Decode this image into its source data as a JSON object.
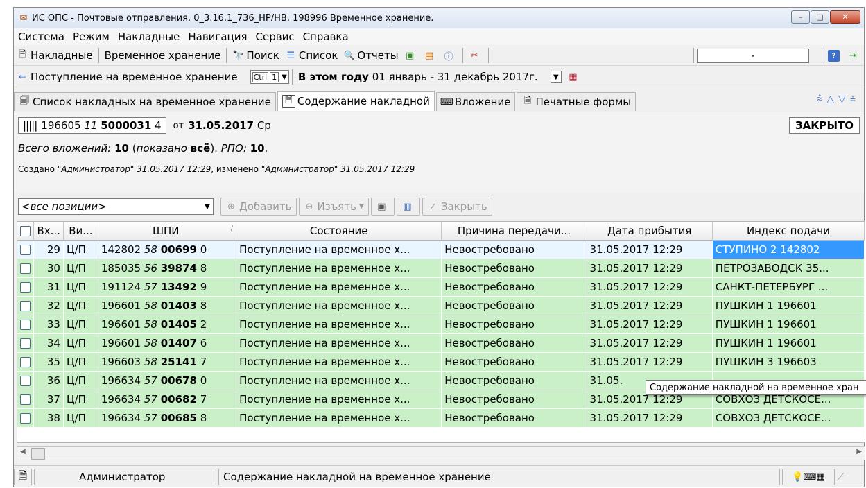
{
  "window": {
    "title": "ИС ОПС - Почтовые отправления. 0_3.16.1_736_НР/НВ. 198996 Временное хранение.",
    "btn_min": "–",
    "btn_max": "□",
    "btn_close": "✕"
  },
  "menu": [
    "Система",
    "Режим",
    "Накладные",
    "Навигация",
    "Сервис",
    "Справка"
  ],
  "toolbar1": {
    "invoices": "Накладные",
    "storage": "Временное хранение",
    "search": "Поиск",
    "list": "Список",
    "reports": "Отчеты",
    "field_value": "-"
  },
  "toolbar2": {
    "mode": "Поступление на временное хранение",
    "hotkey": "Ctrl",
    "hotkey_num": "1",
    "period_bold": "В этом году",
    "period_range": "01 январь - 31 декабрь 2017г."
  },
  "tabs": [
    {
      "label": "Список накладных на временное хранение"
    },
    {
      "label": "Содержание накладной"
    },
    {
      "label": "Вложение"
    },
    {
      "label": "Печатные формы"
    }
  ],
  "invoice": {
    "num_prefix": "196605",
    "num_italic": "11",
    "num_bold": "5000031",
    "num_suffix": "4",
    "from_label": "от",
    "date": "31.05.2017",
    "weekday": "Ср",
    "status": "ЗАКРЫТО",
    "total_label": "Всего вложений:",
    "total_value": "10",
    "shown_label": "показано",
    "shown_value": "всё",
    "rpo_label": "РПО:",
    "rpo_value": "10",
    "created_text": "Создано",
    "created_by": "\"Администратор\" 31.05.2017 12:29",
    "changed_text": ", изменено",
    "changed_by": "\"Администратор\" 31.05.2017 12:29"
  },
  "filter": {
    "positions": "<все позиции>",
    "add": "Добавить",
    "remove": "Изъять",
    "close": "Закрыть"
  },
  "grid": {
    "columns": [
      "Вх...",
      "Ви...",
      "ШПИ",
      "Состояние",
      "Причина передачи...",
      "Дата прибытия",
      "Индекс подачи"
    ],
    "rows": [
      {
        "n": "29",
        "type": "Ц/П",
        "a": "142802",
        "b": "58",
        "c": "00699",
        "d": "0",
        "state": "Поступление на временное х...",
        "reason": "Невостребовано",
        "date": "31.05.2017 12:29",
        "index": "СТУПИНО 2 142802"
      },
      {
        "n": "30",
        "type": "Ц/П",
        "a": "185035",
        "b": "56",
        "c": "39874",
        "d": "8",
        "state": "Поступление на временное х...",
        "reason": "Невостребовано",
        "date": "31.05.2017 12:29",
        "index": "ПЕТРОЗАВОДСК 35..."
      },
      {
        "n": "31",
        "type": "Ц/П",
        "a": "191124",
        "b": "57",
        "c": "13492",
        "d": "9",
        "state": "Поступление на временное х...",
        "reason": "Невостребовано",
        "date": "31.05.2017 12:29",
        "index": "САНКТ-ПЕТЕРБУРГ ..."
      },
      {
        "n": "32",
        "type": "Ц/П",
        "a": "196601",
        "b": "58",
        "c": "01403",
        "d": "8",
        "state": "Поступление на временное х...",
        "reason": "Невостребовано",
        "date": "31.05.2017 12:29",
        "index": "ПУШКИН 1 196601"
      },
      {
        "n": "33",
        "type": "Ц/П",
        "a": "196601",
        "b": "58",
        "c": "01405",
        "d": "2",
        "state": "Поступление на временное х...",
        "reason": "Невостребовано",
        "date": "31.05.2017 12:29",
        "index": "ПУШКИН 1 196601"
      },
      {
        "n": "34",
        "type": "Ц/П",
        "a": "196601",
        "b": "58",
        "c": "01407",
        "d": "6",
        "state": "Поступление на временное х...",
        "reason": "Невостребовано",
        "date": "31.05.2017 12:29",
        "index": "ПУШКИН 1 196601"
      },
      {
        "n": "35",
        "type": "Ц/П",
        "a": "196603",
        "b": "58",
        "c": "25141",
        "d": "7",
        "state": "Поступление на временное х...",
        "reason": "Невостребовано",
        "date": "31.05.2017 12:29",
        "index": "ПУШКИН 3 196603"
      },
      {
        "n": "36",
        "type": "Ц/П",
        "a": "196634",
        "b": "57",
        "c": "00678",
        "d": "0",
        "state": "Поступление на временное х...",
        "reason": "Невостребовано",
        "date": "31.05.",
        "index": ""
      },
      {
        "n": "37",
        "type": "Ц/П",
        "a": "196634",
        "b": "57",
        "c": "00682",
        "d": "7",
        "state": "Поступление на временное х...",
        "reason": "Невостребовано",
        "date": "31.05.2017 12:29",
        "index": "СОВХОЗ ДЕТСКОСЕ..."
      },
      {
        "n": "38",
        "type": "Ц/П",
        "a": "196634",
        "b": "57",
        "c": "00685",
        "d": "8",
        "state": "Поступление на временное х...",
        "reason": "Невостребовано",
        "date": "31.05.2017 12:29",
        "index": "СОВХОЗ ДЕТСКОСЕ..."
      }
    ]
  },
  "tooltip": "Содержание накладной на временное хран",
  "status": {
    "user": "Администратор",
    "message": "Содержание накладной на временное хранение"
  }
}
